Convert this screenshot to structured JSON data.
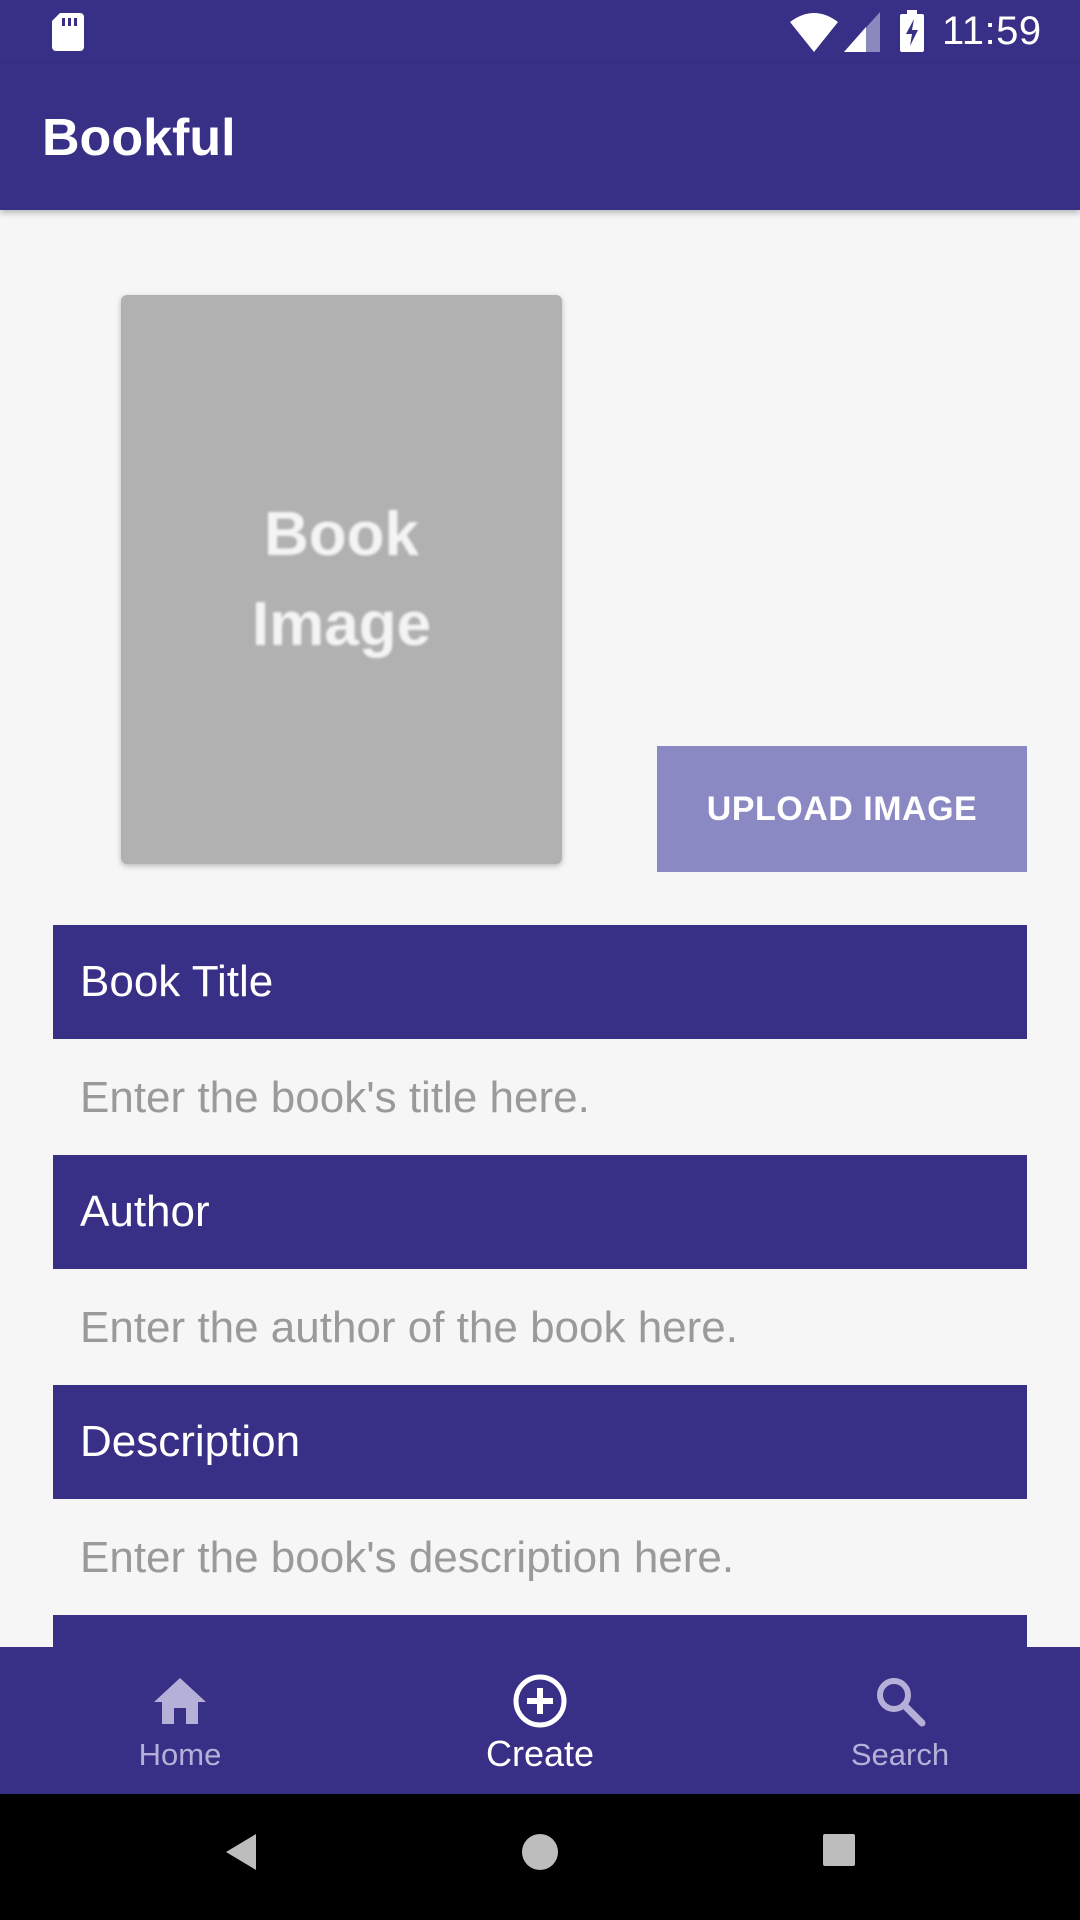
{
  "status_bar": {
    "time": "11:59",
    "icons": [
      "sd-card-icon",
      "wifi-icon",
      "signal-icon",
      "battery-charging-icon"
    ]
  },
  "app_bar": {
    "title": "Bookful"
  },
  "book_image": {
    "placeholder_text_line1": "Book",
    "placeholder_text_line2": "Image"
  },
  "upload_button": {
    "label": "UPLOAD IMAGE"
  },
  "fields": [
    {
      "header": "Book Title",
      "value": "",
      "placeholder": "Enter the book's title here."
    },
    {
      "header": "Author",
      "value": "",
      "placeholder": "Enter the author of the book here."
    },
    {
      "header": "Description",
      "value": "",
      "placeholder": "Enter the book's description here."
    }
  ],
  "bottom_nav": {
    "items": [
      {
        "label": "Home",
        "icon": "home-icon",
        "active": false
      },
      {
        "label": "Create",
        "icon": "add-circle-icon",
        "active": true
      },
      {
        "label": "Search",
        "icon": "search-icon",
        "active": false
      }
    ]
  },
  "system_nav": {
    "icons": [
      "back-icon",
      "home-circle-icon",
      "recents-icon"
    ]
  },
  "colors": {
    "primary": "#382f86",
    "upload_button": "#8a89c4",
    "placeholder_box": "#b1b1b1",
    "background": "#f6f6f7",
    "hint_text": "#9a9a9a"
  }
}
